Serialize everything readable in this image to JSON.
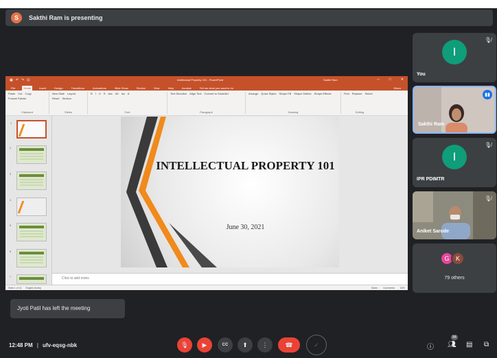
{
  "presenter_bar": {
    "avatar_letter": "S",
    "text": "Sakthi Ram is presenting"
  },
  "ppt": {
    "doc_title": "Intellectual Property 101 - PowerPoint",
    "user": "Sakthi Ram",
    "tabs": [
      "File",
      "Home",
      "Insert",
      "Design",
      "Transitions",
      "Animations",
      "Slide Show",
      "Review",
      "View",
      "Help",
      "Acrobat",
      "Tell me what you want to do"
    ],
    "active_tab": "Home",
    "share": "Share",
    "ribbon": [
      {
        "label": "Clipboard",
        "cmds": [
          "Paste",
          "Cut",
          "Copy",
          "Format Painter"
        ]
      },
      {
        "label": "Slides",
        "cmds": [
          "New Slide",
          "Layout",
          "Reset",
          "Section"
        ]
      },
      {
        "label": "Font",
        "cmds": [
          "B",
          "I",
          "U",
          "S",
          "abc",
          "AV",
          "Aa",
          "A"
        ]
      },
      {
        "label": "Paragraph",
        "cmds": [
          "Text Direction",
          "Align Text",
          "Convert to SmartArt"
        ]
      },
      {
        "label": "Drawing",
        "cmds": [
          "Arrange",
          "Quick Styles",
          "Shape Fill",
          "Shape Outline",
          "Shape Effects"
        ]
      },
      {
        "label": "Editing",
        "cmds": [
          "Find",
          "Replace",
          "Select"
        ]
      }
    ],
    "thumb_numbers": [
      "1",
      "2",
      "3",
      "4",
      "5",
      "6",
      "7"
    ],
    "slide": {
      "title": "INTELLECTUAL PROPERTY 101",
      "date": "June 30, 2021"
    },
    "notes_placeholder": "Click to add notes",
    "status": {
      "slide_count": "Slide 1 of 14",
      "language": "English (India)",
      "notes": "Notes",
      "comments": "Comments",
      "zoom": "63%"
    },
    "colors": {
      "accent": "#c5512b",
      "orange": "#f08a1c",
      "dark": "#3a3a3a"
    }
  },
  "tiles": [
    {
      "name": "You",
      "letter": "I"
    },
    {
      "name": "Sakthi Ram"
    },
    {
      "name": "IPR PDIMTR",
      "letter": "I"
    },
    {
      "name": "Aniket Sarode"
    },
    {
      "others": [
        "G",
        "K"
      ],
      "label": "79 others"
    }
  ],
  "toast": "Jyoti Patil has left the meeting",
  "bottom": {
    "time": "12:48 PM",
    "meeting_code": "ufv-eqsg-nbk",
    "participant_count": "84"
  },
  "icons": {
    "mic_off": "mic-off-icon",
    "cam_off": "camera-off-icon",
    "captions": "captions-icon",
    "present": "present-icon",
    "more": "more-icon",
    "hangup": "hangup-icon",
    "info": "info-icon",
    "people": "people-icon",
    "chat": "chat-icon",
    "activities": "activities-icon"
  }
}
